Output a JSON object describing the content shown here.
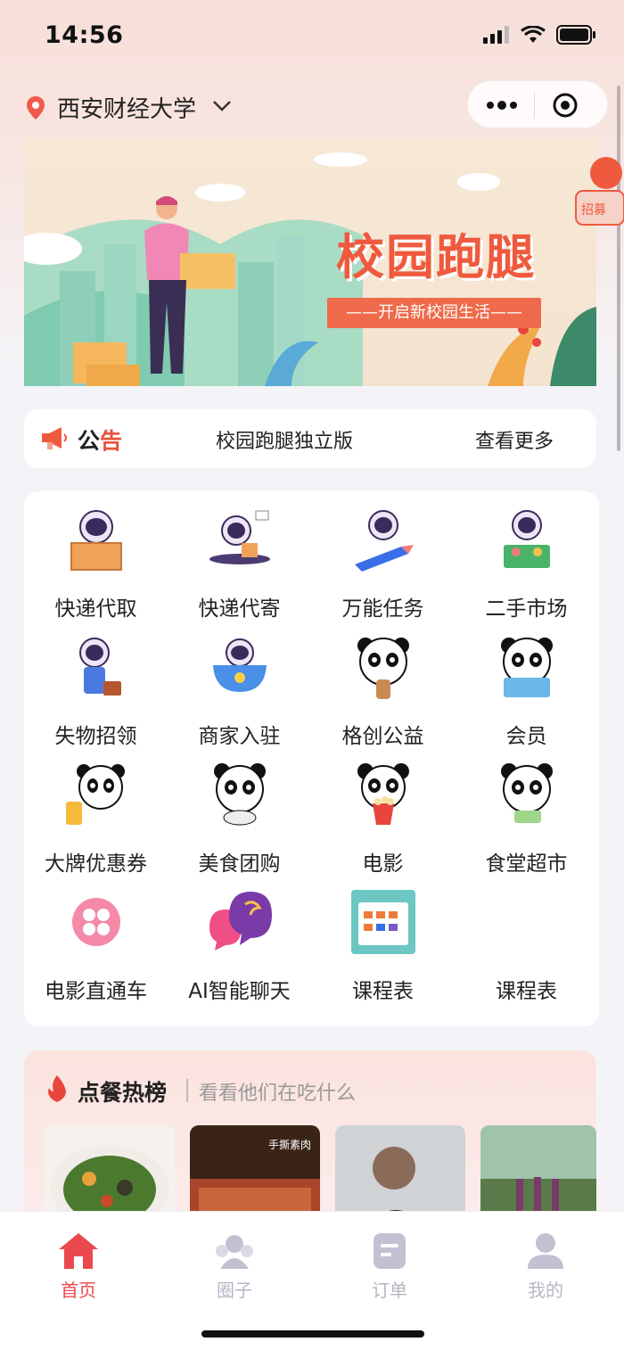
{
  "status": {
    "time": "14:56"
  },
  "location": {
    "school": "西安财经大学"
  },
  "banner": {
    "title": "校园跑腿",
    "subtitle": "——开启新校园生活——",
    "side_badge": "招募"
  },
  "notice": {
    "title_a": "公",
    "title_b": "告",
    "text": "校园跑腿独立版",
    "more": "查看更多"
  },
  "grid": {
    "items": [
      {
        "label": "快递代取",
        "icon": "astronaut-box-icon"
      },
      {
        "label": "快递代寄",
        "icon": "astronaut-parcel-icon"
      },
      {
        "label": "万能任务",
        "icon": "astronaut-pencil-icon"
      },
      {
        "label": "二手市场",
        "icon": "astronaut-market-icon"
      },
      {
        "label": "失物招领",
        "icon": "astronaut-briefcase-icon"
      },
      {
        "label": "商家入驻",
        "icon": "astronaut-cup-icon"
      },
      {
        "label": "格创公益",
        "icon": "panda-charity-icon"
      },
      {
        "label": "会员",
        "icon": "panda-member-icon"
      },
      {
        "label": "大牌优惠券",
        "icon": "panda-coupon-icon"
      },
      {
        "label": "美食团购",
        "icon": "panda-food-icon"
      },
      {
        "label": "电影",
        "icon": "panda-popcorn-icon"
      },
      {
        "label": "食堂超市",
        "icon": "panda-canteen-icon"
      },
      {
        "label": "电影直通车",
        "icon": "flower-icon"
      },
      {
        "label": "AI智能聊天",
        "icon": "chat-bubbles-icon"
      },
      {
        "label": "课程表",
        "icon": "calendar-grid-icon"
      },
      {
        "label": "课程表",
        "icon": ""
      }
    ]
  },
  "hot": {
    "title": "点餐热榜",
    "subtitle": "看看他们在吃什么",
    "thumb2_caption": "手撕素肉"
  },
  "tabbar": {
    "items": [
      {
        "label": "首页",
        "icon": "home-icon",
        "active": true
      },
      {
        "label": "圈子",
        "icon": "community-icon",
        "active": false
      },
      {
        "label": "订单",
        "icon": "order-icon",
        "active": false
      },
      {
        "label": "我的",
        "icon": "profile-icon",
        "active": false
      }
    ]
  },
  "colors": {
    "accent": "#ea4a4e",
    "banner_red": "#ef5a3e",
    "tab_inactive": "#b8b4c4"
  }
}
